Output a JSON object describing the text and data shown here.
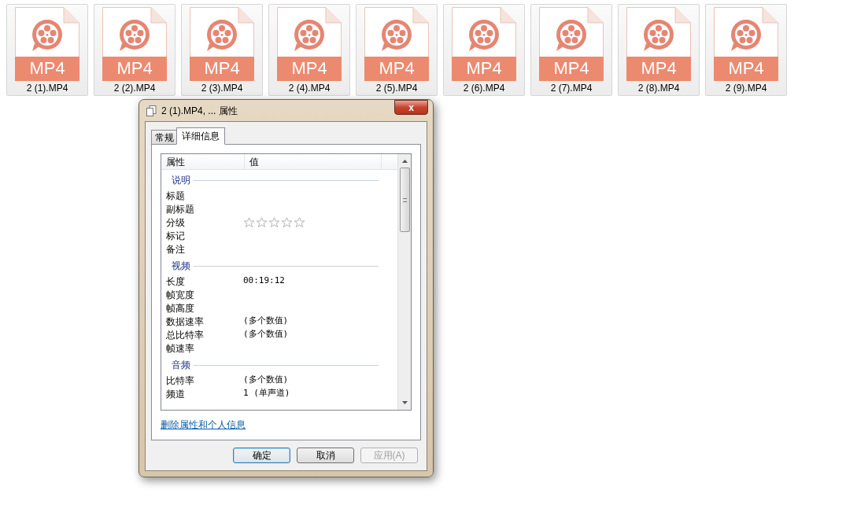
{
  "files": [
    {
      "label": "MP4",
      "name": "2 (1).MP4"
    },
    {
      "label": "MP4",
      "name": "2 (2).MP4"
    },
    {
      "label": "MP4",
      "name": "2 (3).MP4"
    },
    {
      "label": "MP4",
      "name": "2 (4).MP4"
    },
    {
      "label": "MP4",
      "name": "2 (5).MP4"
    },
    {
      "label": "MP4",
      "name": "2 (6).MP4"
    },
    {
      "label": "MP4",
      "name": "2 (7).MP4"
    },
    {
      "label": "MP4",
      "name": "2 (8).MP4"
    },
    {
      "label": "MP4",
      "name": "2 (9).MP4"
    }
  ],
  "dialog": {
    "title": "2 (1).MP4, ... 属性",
    "close": "x",
    "tabs": [
      {
        "label": "常规",
        "selected": false
      },
      {
        "label": "详细信息",
        "selected": true
      }
    ],
    "table": {
      "columns": [
        "属性",
        "值"
      ],
      "sections": [
        {
          "title": "说明",
          "rows": [
            {
              "kind": "text",
              "name": "标题"
            },
            {
              "kind": "text",
              "name": "副标题"
            },
            {
              "kind": "rating",
              "name": "分级",
              "stars": 0
            },
            {
              "kind": "text",
              "name": "标记"
            },
            {
              "kind": "text",
              "name": "备注"
            }
          ]
        },
        {
          "title": "视频",
          "rows": [
            {
              "kind": "text",
              "name": "长度",
              "value": "00:19:12"
            },
            {
              "kind": "text",
              "name": "帧宽度"
            },
            {
              "kind": "text",
              "name": "帧高度"
            },
            {
              "kind": "text",
              "name": "数据速率",
              "value": "(多个数值)"
            },
            {
              "kind": "text",
              "name": "总比特率",
              "value": "(多个数值)"
            },
            {
              "kind": "text",
              "name": "帧速率"
            }
          ]
        },
        {
          "title": "音频",
          "rows": [
            {
              "kind": "text",
              "name": "比特率",
              "value": "(多个数值)"
            },
            {
              "kind": "text",
              "name": "频道",
              "value": "1 (单声道)"
            }
          ]
        }
      ]
    },
    "link": "删除属性和个人信息",
    "buttons": [
      {
        "label": "确定",
        "default": true,
        "disabled": false
      },
      {
        "label": "取消",
        "default": false,
        "disabled": false
      },
      {
        "label": "应用(A)",
        "default": false,
        "disabled": true
      }
    ]
  }
}
